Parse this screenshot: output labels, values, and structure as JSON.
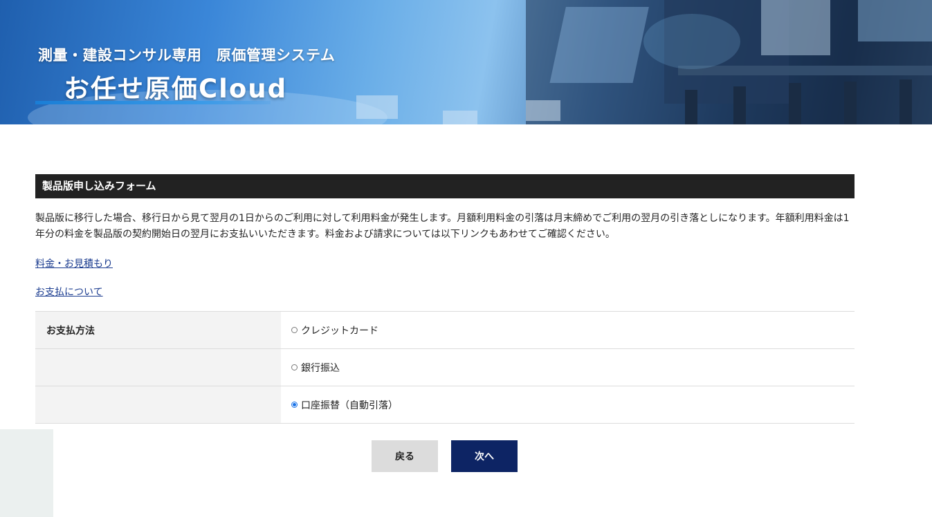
{
  "banner": {
    "subtitle": "測量・建設コンサル専用　原価管理システム",
    "title": "お任せ原価Cloud"
  },
  "form": {
    "header": "製品版申し込みフォーム",
    "description": "製品版に移行した場合、移行日から見て翌月の1日からのご利用に対して利用料金が発生します。月額利用料金の引落は月末締めでご利用の翌月の引き落としになります。年額利用料金は1年分の料金を製品版の契約開始日の翌月にお支払いいただきます。料金および請求については以下リンクもあわせてご確認ください。",
    "links": {
      "pricing": "料金・お見積もり",
      "payment_info": "お支払について"
    },
    "payment_method": {
      "label": "お支払方法",
      "options": [
        {
          "label": "クレジットカード",
          "checked": false
        },
        {
          "label": "銀行振込",
          "checked": false
        },
        {
          "label": "口座振替（自動引落）",
          "checked": true
        }
      ]
    }
  },
  "buttons": {
    "back": "戻る",
    "next": "次へ"
  },
  "colors": {
    "header_bg": "#222222",
    "next_button": "#0d2464",
    "back_button": "#dcdcdc",
    "link": "#1a3b8f",
    "radio_checked": "#1a73e8",
    "label_cell_bg": "#f3f3f3"
  }
}
